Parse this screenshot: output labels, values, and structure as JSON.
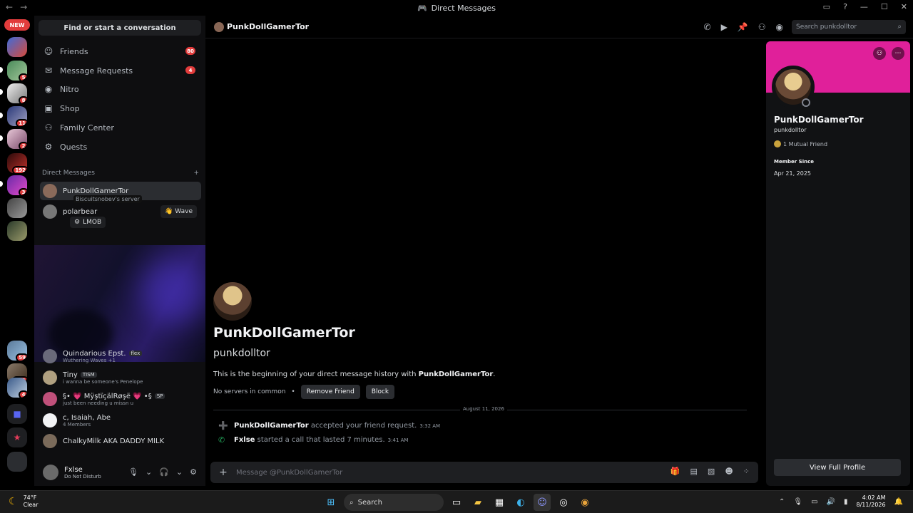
{
  "window": {
    "title": "Direct Messages"
  },
  "guilds": {
    "new_label": "NEW",
    "badges": [
      "5",
      "8",
      "11",
      "2",
      "192",
      "3",
      "",
      "59",
      "291",
      "4"
    ]
  },
  "sidebar": {
    "find_button": "Find or start a conversation",
    "nav": [
      {
        "label": "Friends",
        "icon": "friends-icon",
        "badge": "80"
      },
      {
        "label": "Message Requests",
        "icon": "mail-icon",
        "badge": "4"
      },
      {
        "label": "Nitro",
        "icon": "nitro-icon",
        "badge": ""
      },
      {
        "label": "Shop",
        "icon": "shop-icon",
        "badge": ""
      },
      {
        "label": "Family Center",
        "icon": "family-icon",
        "badge": ""
      },
      {
        "label": "Quests",
        "icon": "quests-icon",
        "badge": ""
      }
    ],
    "dm_header": "Direct Messages",
    "dm_add": "+",
    "tooltip_server": "Biscuitsnobev's server",
    "tooltip_lmob": "LMOB",
    "dms": [
      {
        "name": "PunkDollGamerTor",
        "sub": ""
      },
      {
        "name": "polarbear",
        "sub": "",
        "wave": "Wave"
      },
      {
        "name": "Quindarious Epst.",
        "tag": "flex",
        "sub": "Wuthering Waves +1"
      },
      {
        "name": "Tiny",
        "tag": "TISM",
        "sub": "i wanna be someone's Penelope"
      },
      {
        "name": "§• 💗 MÿştïçälRøşë 💗 •§",
        "tag": "SP",
        "sub": "just been needing u missn u"
      },
      {
        "name": "c, Isaiah, Abe",
        "sub": "4 Members"
      },
      {
        "name": "ChalkyMilk AKA DADDY MILK",
        "sub": ""
      }
    ],
    "wave_label": "Wave"
  },
  "user": {
    "name": "Fxlse",
    "status": "Do Not Disturb"
  },
  "header": {
    "title": "PunkDollGamerTor",
    "search_placeholder": "Search punkdolltor"
  },
  "chat": {
    "display_name": "PunkDollGamerTor",
    "username": "punkdolltor",
    "intro_prefix": "This is the beginning of your direct message history with ",
    "intro_name": "PunkDollGamerTor",
    "intro_suffix": ".",
    "no_servers": "No servers in common",
    "remove_friend": "Remove Friend",
    "block": "Block",
    "date_divider": "August 11, 2026",
    "messages": [
      {
        "actor": "PunkDollGamerTor",
        "text": " accepted your friend request.",
        "time": "3:32 AM",
        "icon": "add-friend-icon"
      },
      {
        "actor": "Fxlse",
        "text": " started a call that lasted 7 minutes.",
        "time": "3:41 AM",
        "icon": "phone-icon"
      }
    ],
    "composer_placeholder": "Message @PunkDollGamerTor"
  },
  "profile": {
    "name": "PunkDollGamerTor",
    "username": "punkdolltor",
    "mutual": "1 Mutual Friend",
    "member_since_label": "Member Since",
    "member_since": "Apr 21, 2025",
    "full_profile": "View Full Profile",
    "banner_color": "#e0209a"
  },
  "taskbar": {
    "temp": "74°F",
    "weather": "Clear",
    "search": "Search",
    "time": "4:02 AM",
    "date": "8/11/2026"
  }
}
